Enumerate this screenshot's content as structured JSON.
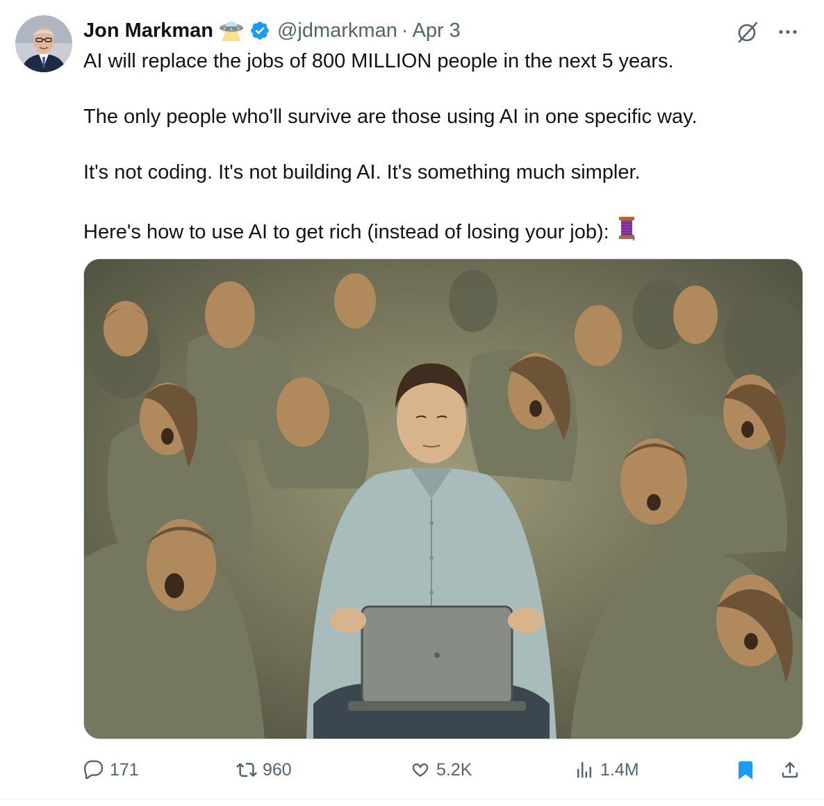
{
  "author": {
    "name": "Jon Markman",
    "handle": "@jdmarkman",
    "separator": "·",
    "date": "Apr 3",
    "name_emoji": "ufo-emoji",
    "verified_color": "#1d9bf0"
  },
  "tweet": {
    "paragraphs": [
      "AI will replace the jobs of 800 MILLION people in the next 5 years.",
      "The only people who'll survive are those using AI in one specific way.",
      "It's not coding. It's not building AI. It's something much simpler.",
      "Here's how to use AI to get rich (instead of losing your job):"
    ],
    "thread_emoji": "thread-spool-emoji"
  },
  "media": {
    "icon": "illustration-image"
  },
  "metrics": {
    "replies": "171",
    "reposts": "960",
    "likes": "5.2K",
    "views": "1.4M"
  },
  "colors": {
    "text": "#0f1419",
    "secondary": "#536471",
    "accent": "#1d9bf0"
  }
}
